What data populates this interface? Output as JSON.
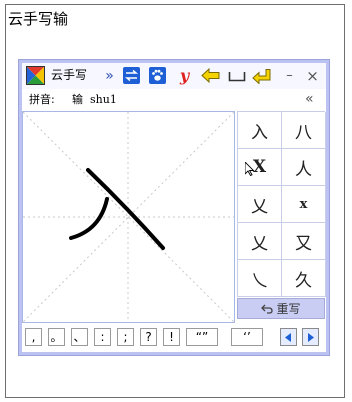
{
  "page": {
    "title": "云手写输"
  },
  "titlebar": {
    "app_name": "云手写",
    "expand_glyph": "»",
    "icons": [
      "app-logo-icon",
      "double-chevron-right-icon",
      "swap-icon",
      "paw-icon",
      "y-icon",
      "backspace-arrow-icon",
      "space-icon",
      "enter-icon",
      "minimize-icon",
      "close-icon"
    ],
    "minimize_glyph": "–",
    "close_glyph": "×"
  },
  "pinyin": {
    "label": "拼音:",
    "char": "输",
    "romanization": "shu1",
    "collapse_glyph": "«"
  },
  "candidates": [
    "入",
    "八",
    "X",
    "人",
    "乂",
    "x",
    "乂",
    "又",
    "乀",
    "久"
  ],
  "rewrite_label": "重写",
  "punctuation": [
    ",",
    "。",
    "、",
    ":",
    ";",
    "?",
    "!",
    "“”",
    "‘’"
  ],
  "colors": {
    "frame": "#bcc3f2",
    "button": "#c9cdf3",
    "accent_blue": "#1e5fd6",
    "yellow": "#f5d300",
    "red_y": "#e02020"
  }
}
